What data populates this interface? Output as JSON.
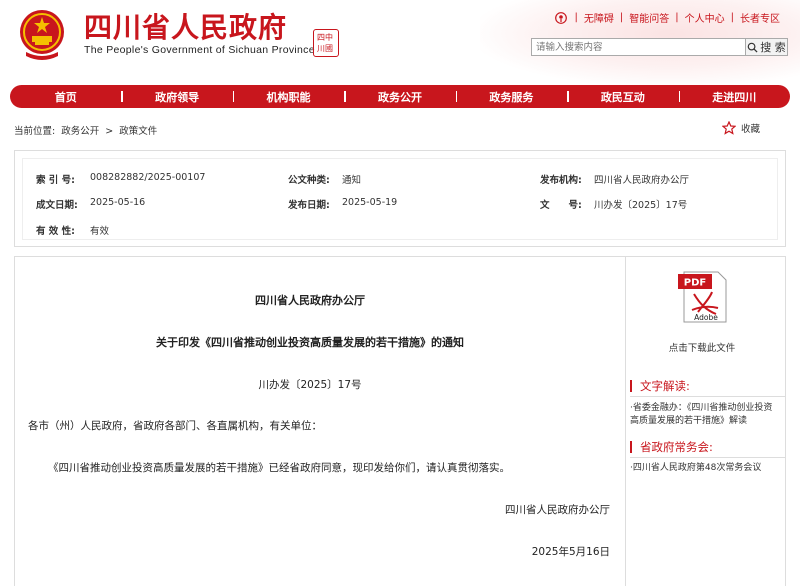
{
  "header": {
    "site_title": "四川省人民政府",
    "site_subtitle": "The People's Government of Sichuan Province",
    "seal_text": "四中\n川國",
    "top_links": [
      "无障碍",
      "智能问答",
      "个人中心",
      "长者专区"
    ],
    "search_placeholder": "请输入搜索内容",
    "search_button": "搜 索"
  },
  "nav": [
    "首页",
    "政府领导",
    "机构职能",
    "政务公开",
    "政务服务",
    "政民互动",
    "走进四川"
  ],
  "breadcrumb": {
    "prefix": "当前位置:",
    "items": [
      "政务公开",
      ">",
      "政策文件"
    ]
  },
  "favorite_label": "收藏",
  "doc_info": {
    "index_label": "索 引 号:",
    "index_value": "008282882/2025-00107",
    "type_label": "公文种类:",
    "type_value": "通知",
    "org_label": "发布机构:",
    "org_value": "四川省人民政府办公厅",
    "created_label": "成文日期:",
    "created_value": "2025-05-16",
    "published_label": "发布日期:",
    "published_value": "2025-05-19",
    "docno_label": "文　　号:",
    "docno_value": "川办发〔2025〕17号",
    "validity_label": "有 效 性:",
    "validity_value": "有效"
  },
  "article": {
    "issuer": "四川省人民政府办公厅",
    "title": "关于印发《四川省推动创业投资高质量发展的若干措施》的通知",
    "doc_number": "川办发〔2025〕17号",
    "addressees": "各市（州）人民政府，省政府各部门、各直属机构，有关单位：",
    "body": "《四川省推动创业投资高质量发展的若干措施》已经省政府同意，现印发给你们，请认真贯彻落实。",
    "signature": "四川省人民政府办公厅",
    "date": "2025年5月16日"
  },
  "sidebar": {
    "download_label": "点击下载此文件",
    "pdf_badge": "PDF",
    "adobe_badge": "Adobe",
    "section1_title": "文字解读:",
    "section1_link": "·省委金融办：《四川省推动创业投资高质量发展的若干措施》解读",
    "section2_title": "省政府常务会:",
    "section2_link": "·四川省人民政府第48次常务会议"
  },
  "colors": {
    "brand_red": "#c8161d"
  }
}
